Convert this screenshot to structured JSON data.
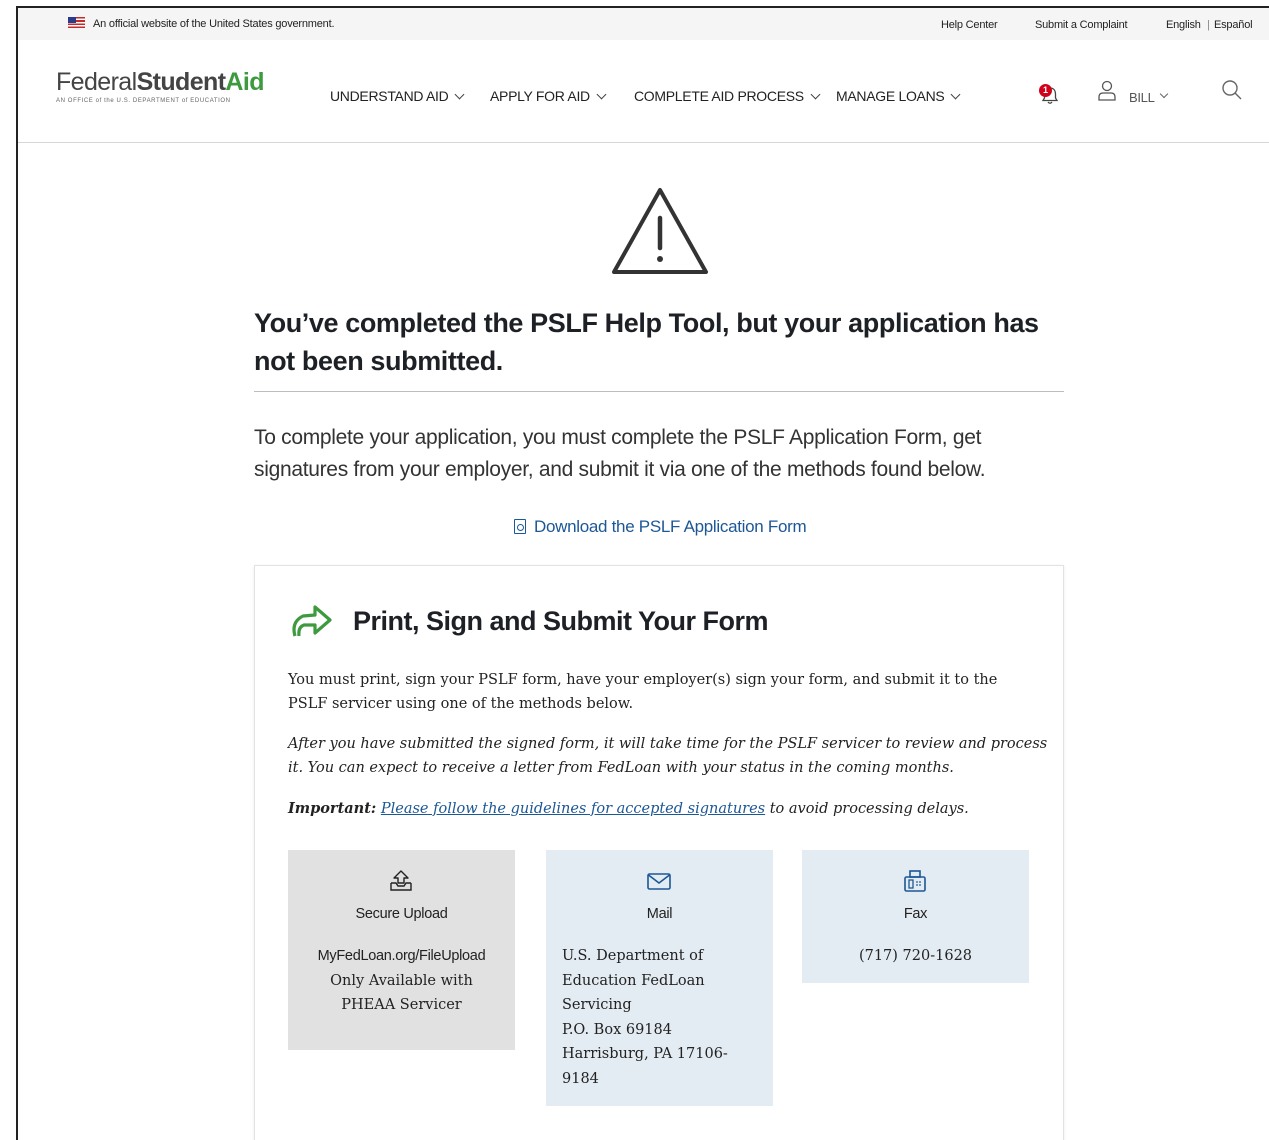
{
  "gov_banner": {
    "text": "An official website of the United States government.",
    "help_center": "Help Center",
    "submit_complaint": "Submit a Complaint",
    "lang_english": "English",
    "lang_separator": "|",
    "lang_espanol": "Español"
  },
  "header": {
    "logo_federal": "Federal",
    "logo_student": "Student",
    "logo_aid": "Aid",
    "logo_tagline": "AN OFFICE of the U.S. DEPARTMENT of EDUCATION",
    "nav": [
      {
        "label": "UNDERSTAND AID"
      },
      {
        "label": "APPLY FOR AID"
      },
      {
        "label": "COMPLETE AID PROCESS"
      },
      {
        "label": "MANAGE LOANS"
      }
    ],
    "notification_count": "1",
    "user_name": "BILL"
  },
  "main": {
    "title": "You’ve completed the PSLF Help Tool, but your application has not been submitted.",
    "lead": "To complete your application, you must complete the PSLF Application Form, get signatures from your employer, and submit it via one of the methods found below.",
    "download_link": "Download the PSLF Application Form"
  },
  "card": {
    "title": "Print, Sign and Submit Your Form",
    "para1": "You must print, sign your PSLF form, have your employer(s) sign your form, and submit it to the PSLF servicer using one of the methods below.",
    "para2": "After you have submitted the signed form, it will take time for the PSLF servicer to review and process it. You can expect to receive a letter from FedLoan with your status in the coming months.",
    "important_label": "Important:",
    "important_link": "Please follow the guidelines for accepted signatures",
    "important_rest": " to avoid processing delays."
  },
  "methods": {
    "upload": {
      "title": "Secure Upload",
      "url": "MyFedLoan.org/FileUpload",
      "line2": "Only Available with",
      "line3": "PHEAA Servicer"
    },
    "mail": {
      "title": "Mail",
      "line1": "U.S. Department of",
      "line2": "Education FedLoan",
      "line3": "Servicing",
      "line4": "P.O. Box 69184",
      "line5": "Harrisburg, PA 17106-",
      "line6": "9184"
    },
    "fax": {
      "title": "Fax",
      "number": "(717) 720-1628"
    }
  },
  "colors": {
    "link": "#1c5796",
    "brand_green": "#3e9a3e",
    "alert_red": "#d0021b",
    "method_gray": "#e1e1e1",
    "method_blue": "#e4ecf3"
  }
}
